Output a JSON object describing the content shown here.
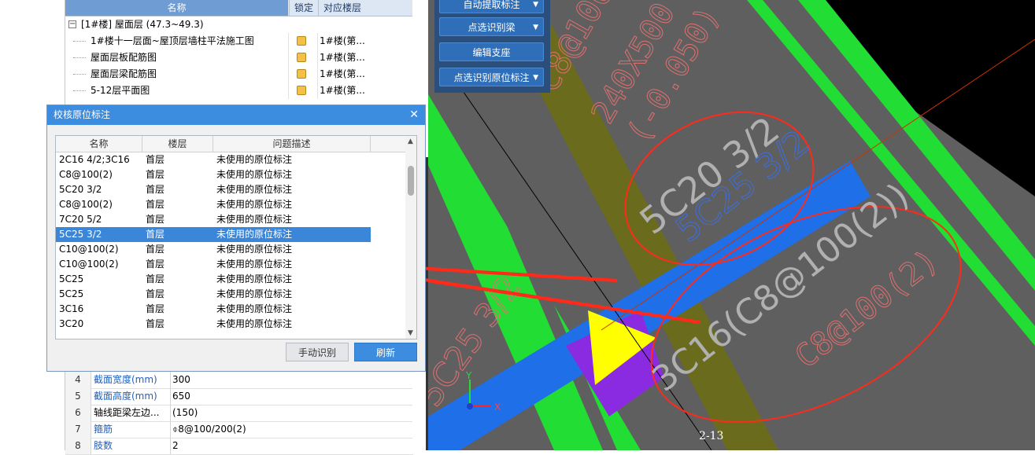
{
  "tree": {
    "headers": {
      "name": "名称",
      "lock": "锁定",
      "floor": "对应楼层"
    },
    "group": "[1#楼] 屋面层 (47.3~49.3)",
    "items": [
      {
        "name": "1#楼十一层面~屋顶层墙柱平法施工图",
        "floor": "1#楼(第..."
      },
      {
        "name": "屋面层板配筋图",
        "floor": "1#楼(第..."
      },
      {
        "name": "屋面层梁配筋图",
        "floor": "1#楼(第..."
      },
      {
        "name": "5-12层平面图",
        "floor": "1#楼(第..."
      }
    ]
  },
  "dialog": {
    "title": "校核原位标注",
    "headers": {
      "name": "名称",
      "floor": "楼层",
      "desc": "问题描述"
    },
    "rows": [
      {
        "name": "2C16 4/2;3C16",
        "floor": "首层",
        "desc": "未使用的原位标注"
      },
      {
        "name": "C8@100(2)",
        "floor": "首层",
        "desc": "未使用的原位标注"
      },
      {
        "name": "5C20 3/2",
        "floor": "首层",
        "desc": "未使用的原位标注"
      },
      {
        "name": "C8@100(2)",
        "floor": "首层",
        "desc": "未使用的原位标注"
      },
      {
        "name": "7C20 5/2",
        "floor": "首层",
        "desc": "未使用的原位标注"
      },
      {
        "name": "5C25 3/2",
        "floor": "首层",
        "desc": "未使用的原位标注",
        "selected": true
      },
      {
        "name": "C10@100(2)",
        "floor": "首层",
        "desc": "未使用的原位标注"
      },
      {
        "name": "C10@100(2)",
        "floor": "首层",
        "desc": "未使用的原位标注"
      },
      {
        "name": "5C25",
        "floor": "首层",
        "desc": "未使用的原位标注"
      },
      {
        "name": "5C25",
        "floor": "首层",
        "desc": "未使用的原位标注"
      },
      {
        "name": "3C16",
        "floor": "首层",
        "desc": "未使用的原位标注"
      },
      {
        "name": "3C20",
        "floor": "首层",
        "desc": "未使用的原位标注"
      }
    ],
    "buttons": {
      "manual": "手动识别",
      "refresh": "刷新"
    }
  },
  "props": [
    {
      "n": "4",
      "k": "截面宽度(mm)",
      "v": "300",
      "blue": true
    },
    {
      "n": "5",
      "k": "截面高度(mm)",
      "v": "650",
      "blue": true
    },
    {
      "n": "6",
      "k": "轴线距梁左边...",
      "v": "(150)",
      "blue": false
    },
    {
      "n": "7",
      "k": "箍筋",
      "v": "⌽8@100/200(2)",
      "blue": true
    },
    {
      "n": "8",
      "k": "肢数",
      "v": "2",
      "blue": true
    }
  ],
  "toolbar": [
    {
      "label": "自动提取标注",
      "dropdown": true
    },
    {
      "label": "点选识别梁",
      "dropdown": true
    },
    {
      "label": "编辑支座",
      "dropdown": false
    },
    {
      "label": "点选识别原位标注",
      "dropdown": true
    }
  ],
  "cad": {
    "texts": [
      "C8@100(2)",
      "240X500",
      "(-0.050)",
      "5C20 3/2",
      "5C25 3/2",
      "3C16(C8@100(2))",
      "C8@100(2)",
      "5C25 3/2"
    ],
    "axis_x": "X",
    "axis_y": "Y",
    "grid_label": "2-13"
  },
  "colors": {
    "beam_blue": "#1e6fe8",
    "column_green": "#22dd33",
    "olive": "#6b6b1e",
    "annotation_red": "#ff2a1a",
    "title_blue": "#3c8ce0"
  }
}
